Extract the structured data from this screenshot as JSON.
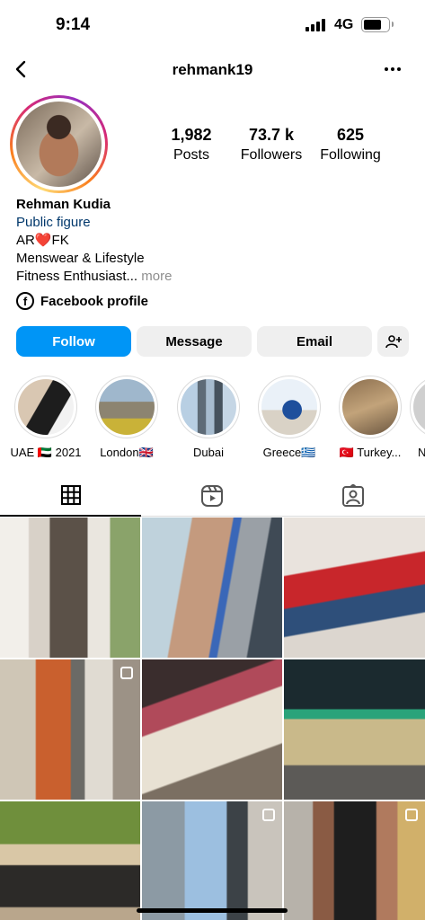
{
  "status_bar": {
    "time": "9:14",
    "network": "4G"
  },
  "header": {
    "username": "rehmank19"
  },
  "profile": {
    "stats": [
      {
        "value": "1,982",
        "label": "Posts"
      },
      {
        "value": "73.7 k",
        "label": "Followers"
      },
      {
        "value": "625",
        "label": "Following"
      }
    ],
    "name": "Rehman Kudia",
    "category": "Public figure",
    "bio_line1_a": "AR",
    "bio_line1_heart": "❤️",
    "bio_line1_b": "FK",
    "bio_line2": "Menswear & Lifestyle",
    "bio_line3": "Fitness Enthusiast...",
    "more_label": "more",
    "facebook_label": "Facebook profile"
  },
  "actions": {
    "follow": "Follow",
    "message": "Message",
    "email": "Email"
  },
  "highlights": [
    {
      "label": "UAE 🇦🇪 2021"
    },
    {
      "label": "London🇬🇧"
    },
    {
      "label": "Dubai"
    },
    {
      "label": "Greece🇬🇷"
    },
    {
      "label": "🇹🇷 Turkey..."
    },
    {
      "label": "N"
    }
  ],
  "tabs": [
    {
      "icon": "grid-icon"
    },
    {
      "icon": "reels-icon"
    },
    {
      "icon": "tagged-icon"
    }
  ],
  "colors": {
    "accent": "#0095f6",
    "category": "#00376b",
    "muted": "#8e8e8e"
  }
}
